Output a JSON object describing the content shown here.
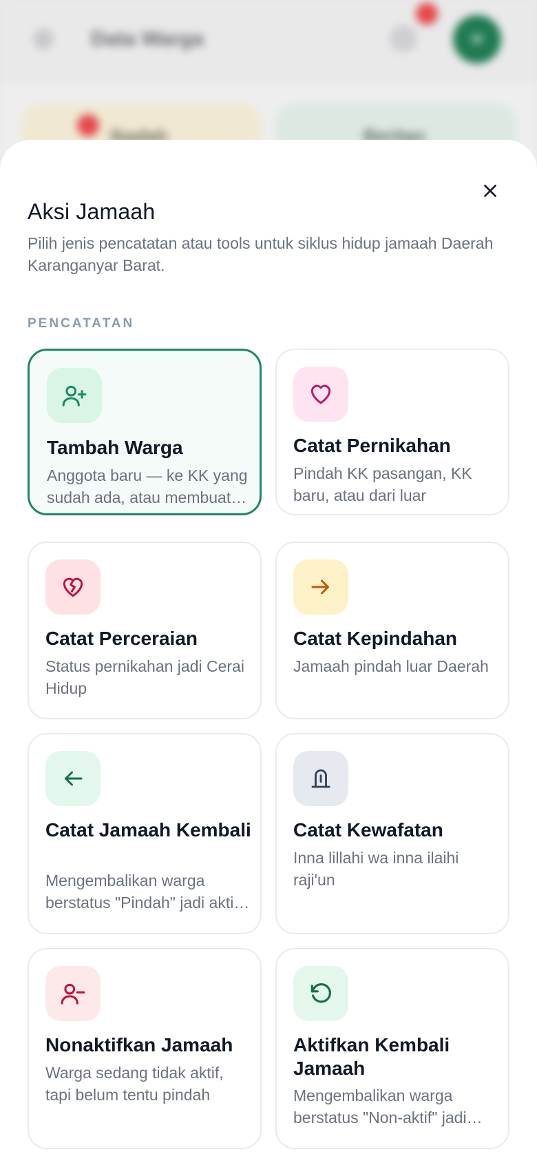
{
  "background": {
    "title": "Data Warga",
    "avatar_initials": "W",
    "card_left_label": "Ibadah",
    "card_right_label": "Beritan"
  },
  "sheet": {
    "title": "Aksi Jamaah",
    "subtitle": "Pilih jenis pencatatan atau tools untuk siklus hidup jamaah Daerah Karanganyar Barat.",
    "section_label": "PENCATATAN",
    "close_icon": "close-icon"
  },
  "actions": [
    {
      "title": "Tambah Warga",
      "desc": "Anggota baru — ke KK yang sudah ada, atau membuat KK baru",
      "icon": "user-plus-icon",
      "color": "#1a8a5f",
      "bg": "#d9f5e6",
      "active": true
    },
    {
      "title": "Catat Pernikahan",
      "desc": "Pindah KK pasangan, KK baru, atau dari luar",
      "icon": "heart-icon",
      "color": "#c0166b",
      "bg": "#fde4f0",
      "active": false
    },
    {
      "title": "Catat Perceraian",
      "desc": "Status pernikahan jadi Cerai Hidup",
      "icon": "heart-crack-icon",
      "color": "#be123c",
      "bg": "#fde1e5",
      "active": false
    },
    {
      "title": "Catat Kepindahan",
      "desc": "Jamaah pindah luar Daerah",
      "icon": "arrow-right-icon",
      "color": "#c2570c",
      "bg": "#fdf1c7",
      "active": false
    },
    {
      "title": "Catat Jamaah Kembali",
      "desc": "Mengembalikan warga berstatus \"Pindah\" jadi aktif kembali",
      "icon": "arrow-left-icon",
      "color": "#15704c",
      "bg": "#e3f7ec",
      "active": false
    },
    {
      "title": "Catat Kewafatan",
      "desc": "Inna lillahi wa inna ilaihi raji'un",
      "icon": "tombstone-icon",
      "color": "#334155",
      "bg": "#e6e9ef",
      "active": false
    },
    {
      "title": "Nonaktifkan Jamaah",
      "desc": "Warga sedang tidak aktif, tapi belum tentu pindah",
      "icon": "user-minus-icon",
      "color": "#be123c",
      "bg": "#fde8ea",
      "active": false
    },
    {
      "title": "Aktifkan Kembali Jamaah",
      "desc": "Mengembalikan warga berstatus \"Non-aktif\" jadi aktif kembali",
      "icon": "rotate-ccw-icon",
      "color": "#15704c",
      "bg": "#e3f7ec",
      "active": false
    }
  ]
}
